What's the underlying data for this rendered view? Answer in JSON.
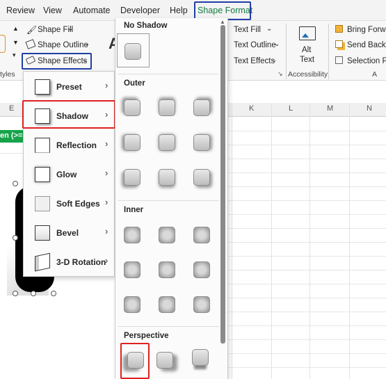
{
  "menubar": {
    "tabs": [
      "Review",
      "View",
      "Automate",
      "Developer",
      "Help"
    ],
    "active_tab": "Shape Format"
  },
  "ribbon": {
    "shape_fill": "Shape Fill",
    "shape_outline": "Shape Outline",
    "shape_effects": "Shape Effects",
    "text_fill": "Text Fill",
    "text_outline": "Text Outline",
    "text_effects": "Text Effects",
    "alt_text_line1": "Alt",
    "alt_text_line2": "Text",
    "bring_forward": "Bring Forwa",
    "send_backward": "Send Backw",
    "selection_pane": "Selection Pa",
    "styles_label": "tyles",
    "accessibility_label": "Accessibility",
    "arrange_label": "A"
  },
  "effects_menu": {
    "items": [
      {
        "label": "Preset",
        "icon": "preset-icon"
      },
      {
        "label": "Shadow",
        "icon": "shadow-icon"
      },
      {
        "label": "Reflection",
        "icon": "reflection-icon"
      },
      {
        "label": "Glow",
        "icon": "glow-icon"
      },
      {
        "label": "Soft Edges",
        "icon": "soft-edges-icon"
      },
      {
        "label": "Bevel",
        "icon": "bevel-icon"
      },
      {
        "label": "3-D Rotation",
        "icon": "3d-rotation-icon"
      }
    ]
  },
  "gallery": {
    "no_shadow": "No Shadow",
    "outer": "Outer",
    "inner": "Inner",
    "perspective": "Perspective"
  },
  "grid": {
    "columns": [
      "E",
      "K",
      "L",
      "M",
      "N"
    ],
    "green_cell_text": "en (>="
  },
  "colors": {
    "accent_blue": "#1f3fa6",
    "highlight_red": "#e02020",
    "excel_green": "#107c41"
  }
}
